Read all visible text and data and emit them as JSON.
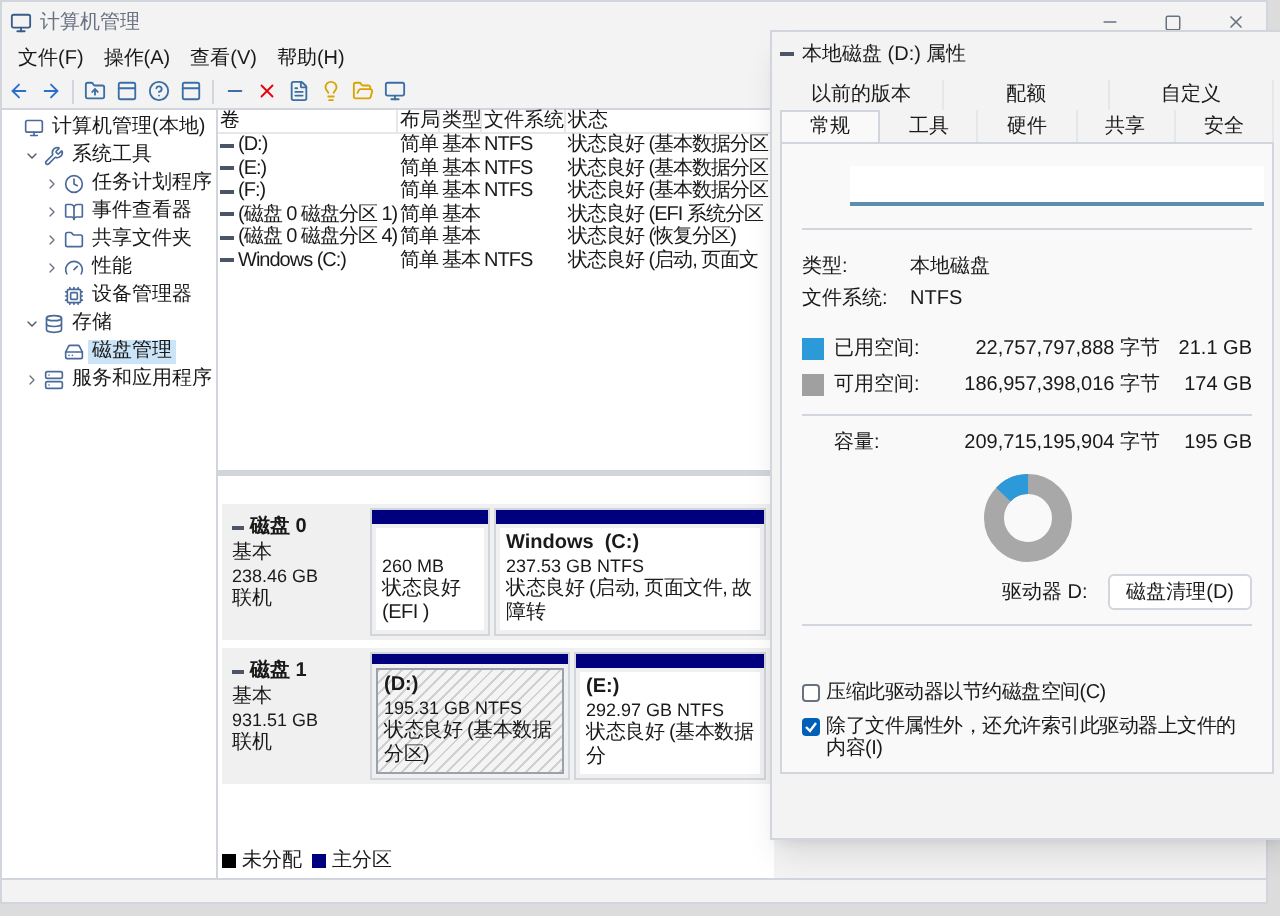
{
  "window": {
    "title": "计算机管理"
  },
  "menu": [
    "文件(F)",
    "操作(A)",
    "查看(V)",
    "帮助(H)"
  ],
  "tree": [
    {
      "label": "计算机管理(本地)",
      "selected": false,
      "children": [
        {
          "label": "系统工具",
          "expanded": true,
          "selected": false,
          "children": [
            {
              "label": "任务计划程序",
              "expanded": false,
              "selected": false
            },
            {
              "label": "事件查看器",
              "expanded": false,
              "selected": false
            },
            {
              "label": "共享文件夹",
              "expanded": false,
              "selected": false
            },
            {
              "label": "性能",
              "expanded": false,
              "selected": false
            },
            {
              "label": "设备管理器",
              "selected": false
            }
          ]
        },
        {
          "label": "存储",
          "expanded": true,
          "selected": false,
          "children": [
            {
              "label": "磁盘管理",
              "selected": true
            }
          ]
        },
        {
          "label": "服务和应用程序",
          "expanded": false,
          "selected": false
        }
      ]
    }
  ],
  "volumes": {
    "columns": [
      "卷",
      "布局",
      "类型",
      "文件系统",
      "状态"
    ],
    "rows": [
      [
        "(D:)",
        "简单",
        "基本",
        "NTFS",
        "状态良好 (基本数据分区"
      ],
      [
        "(E:)",
        "简单",
        "基本",
        "NTFS",
        "状态良好 (基本数据分区"
      ],
      [
        "(F:)",
        "简单",
        "基本",
        "NTFS",
        "状态良好 (基本数据分区"
      ],
      [
        "(磁盘 0 磁盘分区 1)",
        "简单",
        "基本",
        "",
        "状态良好 (EFI 系统分区"
      ],
      [
        "(磁盘 0 磁盘分区 4)",
        "简单",
        "基本",
        "",
        "状态良好 (恢复分区)"
      ],
      [
        "Windows (C:)",
        "简单",
        "基本",
        "NTFS",
        "状态良好 (启动, 页面文"
      ]
    ]
  },
  "disks": [
    {
      "name": "磁盘 0",
      "type": "基本",
      "size": "238.46 GB",
      "status": "联机",
      "partitions": [
        {
          "size": "260 MB",
          "status": "状态良好 (EFI )",
          "selected": false
        },
        {
          "label": "Windows  (C:)",
          "size": "237.53 GB NTFS",
          "status": "状态良好 (启动, 页面文件, 故障转",
          "selected": false
        }
      ]
    },
    {
      "name": "磁盘 1",
      "type": "基本",
      "size": "931.51 GB",
      "status": "联机",
      "partitions": [
        {
          "label": "(D:)",
          "size": "195.31 GB NTFS",
          "status": "状态良好 (基本数据分区)",
          "selected": true
        },
        {
          "label": "(E:)",
          "size": "292.97 GB NTFS",
          "status": "状态良好 (基本数据分",
          "selected": false
        }
      ]
    }
  ],
  "legend": [
    {
      "label": "未分配",
      "color": "#000000"
    },
    {
      "label": "主分区",
      "color": "#00007f"
    }
  ],
  "dialog": {
    "title": "本地磁盘 (D:) 属性",
    "tabs_back": [
      {
        "label": "以前的版本",
        "selected": false
      },
      {
        "label": "配额",
        "selected": false
      },
      {
        "label": "自定义",
        "selected": false
      }
    ],
    "tabs_front": [
      {
        "label": "常规",
        "selected": true
      },
      {
        "label": "工具",
        "selected": false
      },
      {
        "label": "硬件",
        "selected": false
      },
      {
        "label": "共享",
        "selected": false
      },
      {
        "label": "安全",
        "selected": false
      }
    ],
    "info": [
      {
        "label": "类型:",
        "value": "本地磁盘"
      },
      {
        "label": "文件系统:",
        "value": "NTFS"
      }
    ],
    "space": [
      {
        "label": "已用空间:",
        "bytes": "22,757,797,888 字节",
        "size": "21.1 GB",
        "color": "#2c9ad8"
      },
      {
        "label": "可用空间:",
        "bytes": "186,957,398,016 字节",
        "size": "174 GB",
        "color": "#a0a0a0"
      }
    ],
    "capacity": {
      "label": "容量:",
      "bytes": "209,715,195,904 字节",
      "size": "195 GB"
    },
    "drive": "驱动器 D:",
    "cleanup": "磁盘清理(D)",
    "options": [
      {
        "label": "压缩此驱动器以节约磁盘空间(C)",
        "checked": false
      },
      {
        "label": "除了文件属性外，还允许索引此驱动器上文件的内容(I)",
        "checked": true
      }
    ]
  }
}
